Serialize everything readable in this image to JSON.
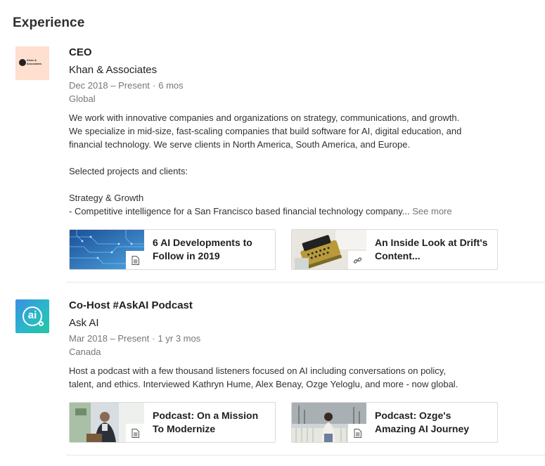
{
  "section": {
    "title": "Experience"
  },
  "experiences": [
    {
      "logo_text": "Khan & Associates",
      "role": "CEO",
      "company": "Khan & Associates",
      "dates": "Dec 2018 – Present",
      "separator": "·",
      "duration": "6 mos",
      "location": "Global",
      "description_lines": [
        "We work with innovative companies and organizations on strategy, communications, and growth.",
        "We specialize in mid-size, fast-scaling companies that build software for AI, digital education, and",
        "financial technology. We serve clients in North America, South America, and Europe.",
        "",
        "Selected projects and clients:",
        "",
        "Strategy & Growth",
        "- Competitive intelligence for a San Francisco based financial technology company..."
      ],
      "see_more": "See more",
      "media": [
        {
          "title": "6 AI Developments to Follow in 2019",
          "icon": "document-icon"
        },
        {
          "title": "An Inside Look at Drift's Content...",
          "icon": "link-icon"
        }
      ]
    },
    {
      "logo_text": "ai",
      "role": "Co-Host #AskAI Podcast",
      "company": "Ask AI",
      "dates": "Mar 2018 – Present",
      "separator": "·",
      "duration": "1 yr 3 mos",
      "location": "Canada",
      "description_lines": [
        "Host a podcast with a few thousand listeners focused on AI including conversations on policy,",
        "talent, and ethics. Interviewed Kathryn Hume, Alex Benay, Ozge Yeloglu, and more - now global."
      ],
      "media": [
        {
          "title": "Podcast: On a Mission To Modernize",
          "icon": "document-icon"
        },
        {
          "title": "Podcast: Ozge's Amazing AI Journey",
          "icon": "document-icon"
        }
      ]
    }
  ],
  "colors": {
    "khan_logo_bg": "#ffdfcf",
    "askai_logo_start": "#3a8fe3",
    "askai_logo_end": "#24c6a2"
  }
}
